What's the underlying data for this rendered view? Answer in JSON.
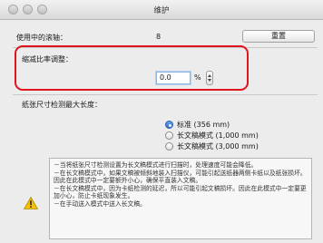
{
  "window": {
    "title": "维护"
  },
  "counter": {
    "label": "使用中的滚轴：",
    "value": "8",
    "reset_label": "重置"
  },
  "scale": {
    "label": "缩减比率调整：",
    "value": "0.0",
    "unit": "%"
  },
  "doc_length": {
    "label": "纸张尺寸检测最大长度：",
    "options": [
      {
        "label": "标准 (356 mm)",
        "selected": true
      },
      {
        "label": "长文稿模式 (1,000 mm)",
        "selected": false
      },
      {
        "label": "长文稿模式 (3,000 mm)",
        "selected": false
      }
    ]
  },
  "notes": [
    "－当将纸张尺寸检测设置为长文稿模式进行扫描时，处理速度可能会降低。",
    "－在长文稿模式中，如果文稿被倾斜地装入扫描仪，可能引起送纸器两侧卡纸以及纸张损坏。因此在此模式中一定要额外小心，确保平直装入文稿。",
    "－在长文稿模式中，因为卡纸检测的延迟，所以可能引起文稿损坏。因此在此模式中一定要更加小心，防止卡纸现象发生。",
    "－在手动送入模式中送入长文稿。"
  ],
  "colors": {
    "highlight": "#e0141c",
    "radio_selected": "#2d6fcf",
    "warning": "#f2c200"
  },
  "icons": {
    "warning": "warning-icon"
  }
}
